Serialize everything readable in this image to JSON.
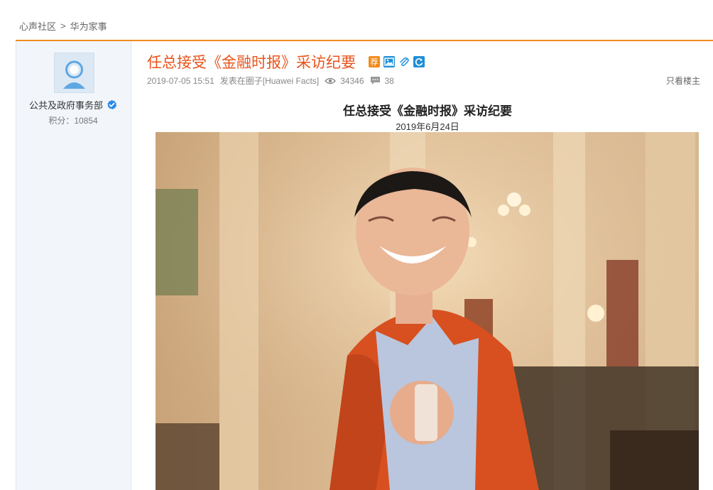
{
  "breadcrumb": {
    "home": "心声社区",
    "separator": ">",
    "section": "华为家事"
  },
  "author": {
    "name": "公共及政府事务部",
    "points_label": "积分：10854"
  },
  "post": {
    "title": "任总接受《金融时报》采访纪要",
    "badges": [
      {
        "name": "recommend-badge",
        "text": "荐",
        "color": "#f08c1e"
      },
      {
        "name": "image-icon",
        "color": "#1e8fd8"
      },
      {
        "name": "attachment-icon",
        "color": "#1e8fd8"
      },
      {
        "name": "refresh-icon",
        "color": "#1e8fd8"
      }
    ],
    "date": "2019-07-05 15:51",
    "posted_in": "发表在圈子[Huawei Facts]",
    "views": "34346",
    "replies": "38",
    "only_host": "只看楼主"
  },
  "content": {
    "title": "任总接受《金融时报》采访纪要",
    "date": "2019年6月24日"
  },
  "colors": {
    "accent": "#f08c1e",
    "title": "#e8541c",
    "sidebar_bg": "#f2f6fb"
  }
}
